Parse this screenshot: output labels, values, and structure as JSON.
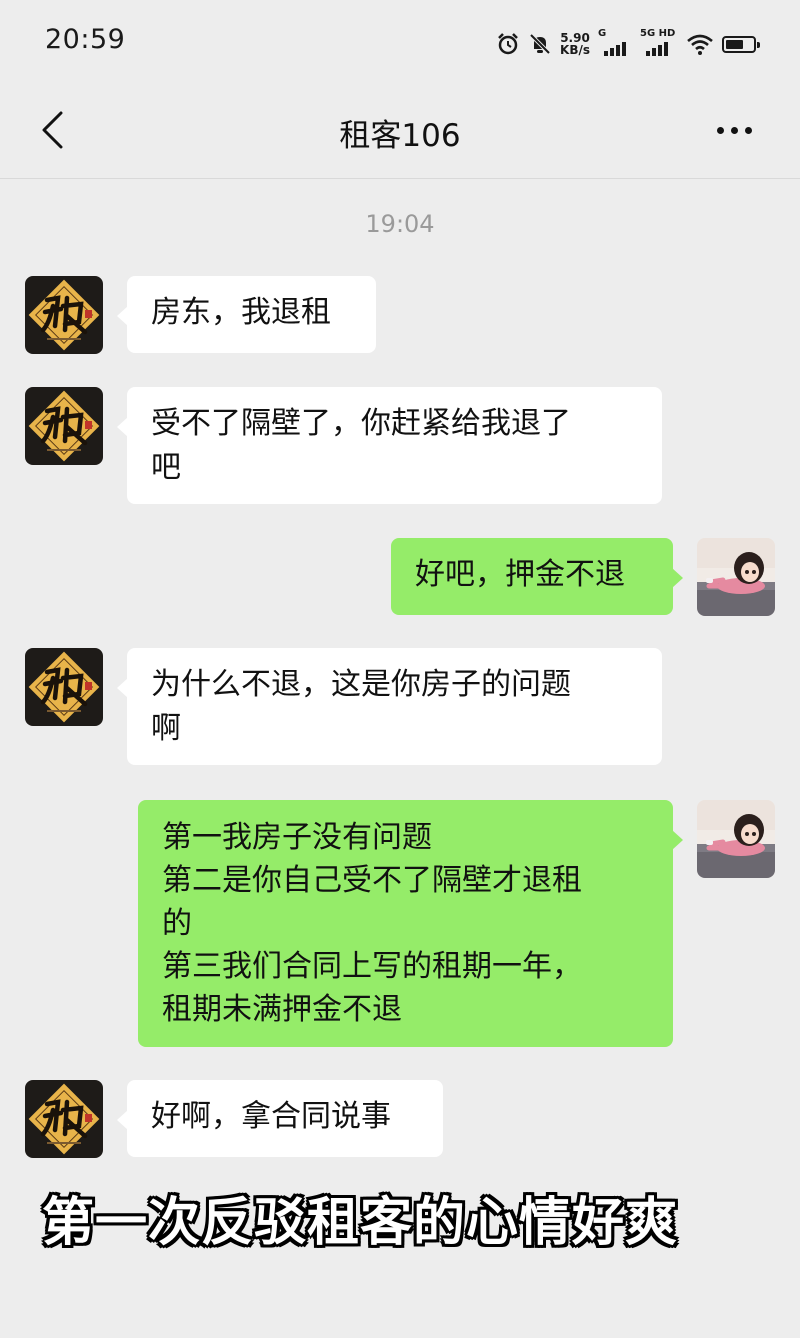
{
  "status_bar": {
    "time": "20:59",
    "net_speed_value": "5.90",
    "net_speed_unit": "KB/s",
    "signal1_label": "G",
    "signal2_label": "5G HD",
    "icons": [
      "alarm-icon",
      "mute-icon",
      "wifi-icon",
      "battery-icon"
    ]
  },
  "header": {
    "title": "租客106"
  },
  "chat": {
    "timestamp": "19:04",
    "messages": [
      {
        "side": "left",
        "text": "房东，我退租"
      },
      {
        "side": "left",
        "text": "受不了隔壁了，你赶紧给我退了\n吧"
      },
      {
        "side": "right",
        "text": "好吧，押金不退"
      },
      {
        "side": "left",
        "text": "为什么不退，这是你房子的问题\n啊"
      },
      {
        "side": "right",
        "text": "第一我房子没有问题\n第二是你自己受不了隔壁才退租\n的\n第三我们合同上写的租期一年，\n租期未满押金不退"
      },
      {
        "side": "left",
        "text": "好啊，拿合同说事"
      }
    ]
  },
  "caption": "第一次反驳租客的心情好爽",
  "colors": {
    "background": "#ededed",
    "incoming_bubble": "#ffffff",
    "outgoing_bubble": "#95ec69"
  }
}
